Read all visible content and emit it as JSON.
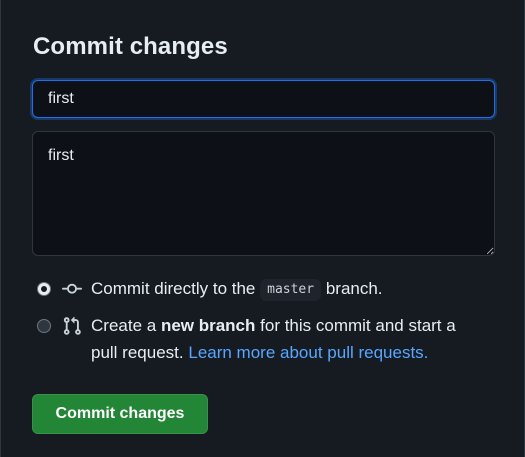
{
  "dialog": {
    "title": "Commit changes",
    "summary_value": "first",
    "description_value": "first"
  },
  "options": {
    "direct": {
      "prefix": "Commit directly to the",
      "branch": "master",
      "suffix": "branch.",
      "checked": true,
      "icon": "git-commit-icon"
    },
    "new_branch": {
      "prefix": "Create a",
      "bold": "new branch",
      "middle": "for this commit and start a pull request.",
      "link": "Learn more about pull requests.",
      "checked": false,
      "icon": "git-pull-request-icon"
    }
  },
  "actions": {
    "commit_label": "Commit changes"
  },
  "colors": {
    "background": "#161b22",
    "accent": "#238636",
    "link": "#58a6ff",
    "focus": "#1f6feb"
  }
}
